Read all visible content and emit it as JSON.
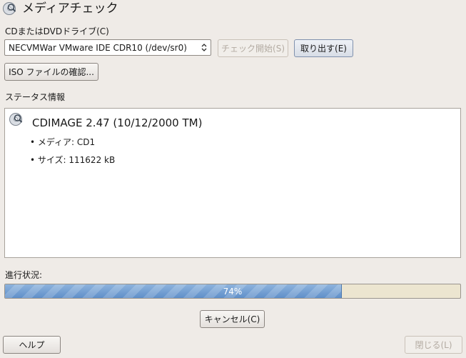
{
  "window": {
    "title": "メディアチェック",
    "title_icon": "media-check-icon"
  },
  "drive": {
    "label": "CDまたはDVDドライブ(C)",
    "selected": "NECVMWar VMware IDE CDR10 (/dev/sr0)"
  },
  "buttons": {
    "start_check": "チェック開始(S)",
    "eject": "取り出す(E)",
    "iso_check": "ISO ファイルの確認...",
    "cancel": "キャンセル(C)",
    "help": "ヘルプ",
    "close": "閉じる(L)"
  },
  "status": {
    "label": "ステータス情報",
    "heading": "CDIMAGE 2.47 (10/12/2000 TM)",
    "lines": [
      "• メディア: CD1",
      "• サイズ: 111622 kB"
    ]
  },
  "progress": {
    "label": "進行状況:",
    "value": 0.74,
    "text": "74%"
  },
  "colors": {
    "window_bg": "#efebe7",
    "progress_fill": "#6f9fd5",
    "progress_track": "#ece5d0"
  }
}
